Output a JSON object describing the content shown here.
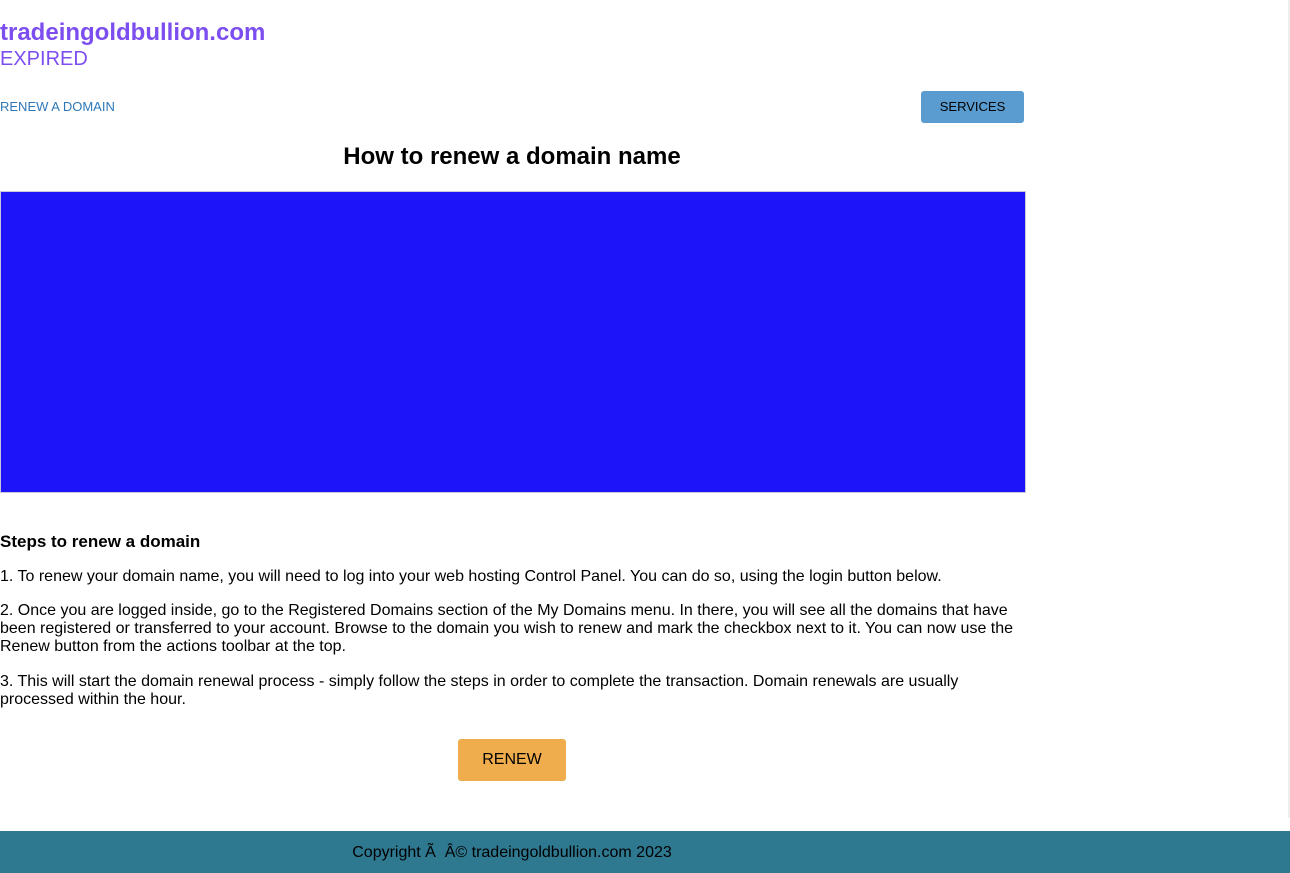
{
  "header": {
    "domain": "tradeingoldbullion.com",
    "status": "EXPIRED"
  },
  "nav": {
    "renew_link": "RENEW A DOMAIN",
    "services_button": "SERVICES"
  },
  "main": {
    "heading": "How to renew a domain name",
    "hero_color": "#1e14fa",
    "steps_heading": "Steps to renew a domain",
    "steps": [
      "1. To renew your domain name, you will need to log into your web hosting Control Panel. You can do so, using the login button below.",
      "2. Once you are logged inside, go to the Registered Domains section of the My Domains menu. In there, you will see all the domains that have been registered or transferred to your account. Browse to the domain you wish to renew and mark the checkbox next to it. You can now use the Renew button from the actions toolbar at the top.",
      "3. This will start the domain renewal process - simply follow the steps in order to complete the transaction. Domain renewals are usually processed within the hour."
    ],
    "renew_button": "RENEW"
  },
  "footer": {
    "copyright": "Copyright Ã  Â© tradeingoldbullion.com 2023"
  },
  "colors": {
    "brand": "#7c4ef0",
    "link": "#2e78b8",
    "services_bg": "#5a9ccf",
    "renew_bg": "#f0ad4e",
    "footer_bg": "#2e7890"
  }
}
